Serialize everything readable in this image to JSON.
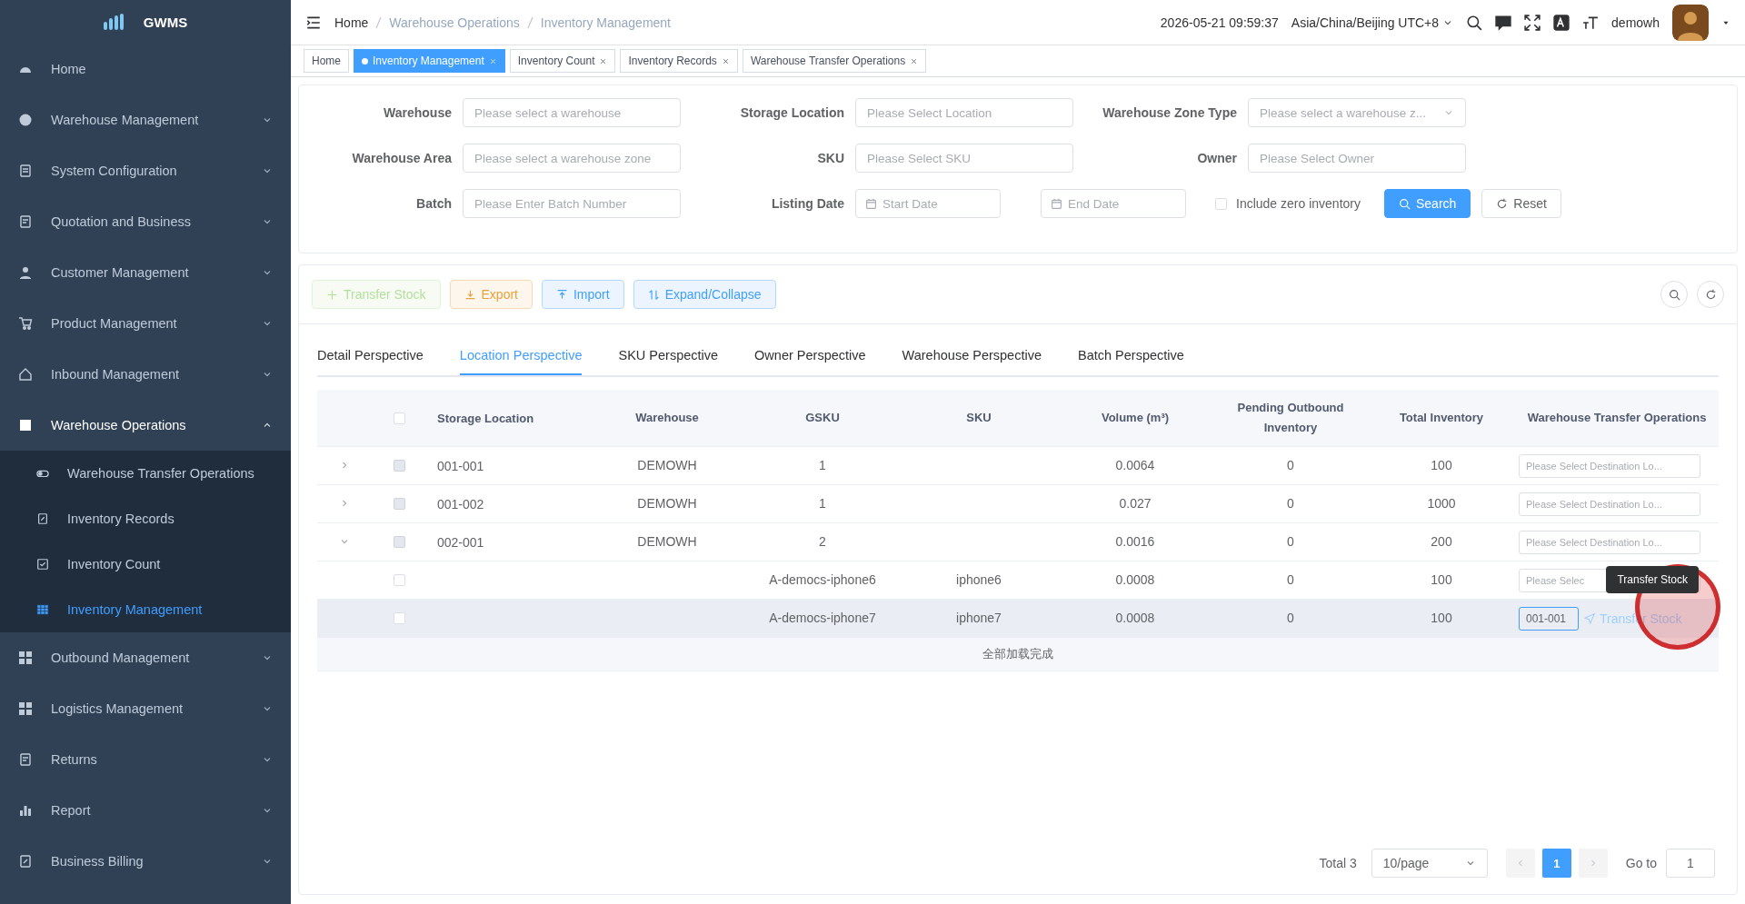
{
  "sidebar": {
    "logo": "GWMS",
    "items": [
      {
        "label": "Home"
      },
      {
        "label": "Warehouse Management",
        "expanded": false
      },
      {
        "label": "System Configuration",
        "expanded": false
      },
      {
        "label": "Quotation and Business",
        "expanded": false
      },
      {
        "label": "Customer Management",
        "expanded": false
      },
      {
        "label": "Product Management",
        "expanded": false
      },
      {
        "label": "Inbound Management",
        "expanded": false
      },
      {
        "label": "Warehouse Operations",
        "expanded": true,
        "children": [
          {
            "label": "Warehouse Transfer Operations",
            "selected": false
          },
          {
            "label": "Inventory Records",
            "selected": false
          },
          {
            "label": "Inventory Count",
            "selected": false
          },
          {
            "label": "Inventory Management",
            "selected": true
          }
        ]
      },
      {
        "label": "Outbound Management",
        "expanded": false
      },
      {
        "label": "Logistics Management",
        "expanded": false
      },
      {
        "label": "Returns",
        "expanded": false
      },
      {
        "label": "Report",
        "expanded": false
      },
      {
        "label": "Business Billing",
        "expanded": false
      }
    ]
  },
  "header": {
    "breadcrumbs": [
      "Home",
      "Warehouse Operations",
      "Inventory Management"
    ],
    "datetime": "2026-05-21 09:59:37",
    "timezone": "Asia/China/Beijing UTC+8",
    "user": "demowh"
  },
  "tags": [
    {
      "label": "Home",
      "selected": false,
      "closable": false
    },
    {
      "label": "Inventory Management",
      "selected": true,
      "closable": true
    },
    {
      "label": "Inventory Count",
      "selected": false,
      "closable": true
    },
    {
      "label": "Inventory Records",
      "selected": false,
      "closable": true
    },
    {
      "label": "Warehouse Transfer Operations",
      "selected": false,
      "closable": true
    }
  ],
  "filters": {
    "rows": [
      [
        {
          "label": "Warehouse",
          "placeholder": "Please select a warehouse",
          "kind": "text"
        },
        {
          "label": "Storage Location",
          "placeholder": "Please Select Location",
          "kind": "text"
        },
        {
          "label": "Warehouse Zone Type",
          "placeholder": "Please select a warehouse z...",
          "kind": "select"
        }
      ],
      [
        {
          "label": "Warehouse Area",
          "placeholder": "Please select a warehouse zone",
          "kind": "text"
        },
        {
          "label": "SKU",
          "placeholder": "Please Select SKU",
          "kind": "text"
        },
        {
          "label": "Owner",
          "placeholder": "Please Select Owner",
          "kind": "text"
        }
      ],
      [
        {
          "label": "Batch",
          "placeholder": "Please Enter Batch Number",
          "kind": "text"
        },
        {
          "label": "Listing Date",
          "kind": "daterange",
          "start_placeholder": "Start Date",
          "end_placeholder": "End Date"
        }
      ]
    ],
    "include_zero": {
      "label": "Include zero inventory",
      "checked": false
    },
    "buttons": [
      {
        "label": "Search",
        "kind": "primary"
      },
      {
        "label": "Reset",
        "kind": "default"
      }
    ]
  },
  "actions": [
    {
      "label": "Transfer Stock",
      "kind": "success",
      "disabled": true
    },
    {
      "label": "Export",
      "kind": "warning",
      "disabled": false
    },
    {
      "label": "Import",
      "kind": "primary",
      "disabled": false
    },
    {
      "label": "Expand/Collapse",
      "kind": "primary",
      "disabled": false
    }
  ],
  "perspectives": [
    {
      "label": "Detail Perspective",
      "selected": false
    },
    {
      "label": "Location Perspective",
      "selected": true
    },
    {
      "label": "SKU Perspective",
      "selected": false
    },
    {
      "label": "Owner Perspective",
      "selected": false
    },
    {
      "label": "Warehouse Perspective",
      "selected": false
    },
    {
      "label": "Batch Perspective",
      "selected": false
    }
  ],
  "table": {
    "columns": [
      "Storage Location",
      "Warehouse",
      "GSKU",
      "SKU",
      "Volume (m³)",
      "Pending Outbound Inventory",
      "Total Inventory",
      "Warehouse Transfer Operations"
    ],
    "header_checked": false,
    "rows": [
      {
        "kind": "group",
        "expanded": false,
        "checked": false,
        "disabled": true,
        "hovered": false,
        "cells": {
          "location": "001-001",
          "warehouse": "DEMOWH",
          "gsku": "1",
          "volume": "0.0064",
          "pending": "0",
          "total": "100"
        },
        "destination": {
          "placeholder": "Please Select Destination Lo..."
        }
      },
      {
        "kind": "group",
        "expanded": false,
        "checked": false,
        "disabled": true,
        "hovered": false,
        "cells": {
          "location": "001-002",
          "warehouse": "DEMOWH",
          "gsku": "1",
          "volume": "0.027",
          "pending": "0",
          "total": "1000"
        },
        "destination": {
          "placeholder": "Please Select Destination Lo..."
        }
      },
      {
        "kind": "group",
        "expanded": true,
        "checked": false,
        "disabled": true,
        "hovered": false,
        "cells": {
          "location": "002-001",
          "warehouse": "DEMOWH",
          "gsku": "2",
          "volume": "0.0016",
          "pending": "0",
          "total": "200"
        },
        "destination": {
          "placeholder": "Please Select Destination Lo..."
        }
      },
      {
        "kind": "item",
        "checked": false,
        "disabled": false,
        "hovered": false,
        "cells": {
          "gsku": "A-democs-iphone6",
          "sku": "iphone6",
          "volume": "0.0008",
          "pending": "0",
          "total": "100"
        },
        "destination": {
          "placeholder": "Please Selec"
        }
      },
      {
        "kind": "item",
        "checked": false,
        "disabled": false,
        "hovered": true,
        "cells": {
          "gsku": "A-democs-iphone7",
          "sku": "iphone7",
          "volume": "0.0008",
          "pending": "0",
          "total": "100"
        },
        "destination": {
          "value": "001-001"
        },
        "action": "Transfer Stock"
      }
    ],
    "footer": "全部加载完成",
    "tooltip": "Transfer Stock"
  },
  "pagination": {
    "total": "Total 3",
    "page_size": "10/page",
    "pages": [
      {
        "label": "1",
        "selected": true
      }
    ],
    "goto_label": "Go to",
    "goto_value": "1"
  }
}
